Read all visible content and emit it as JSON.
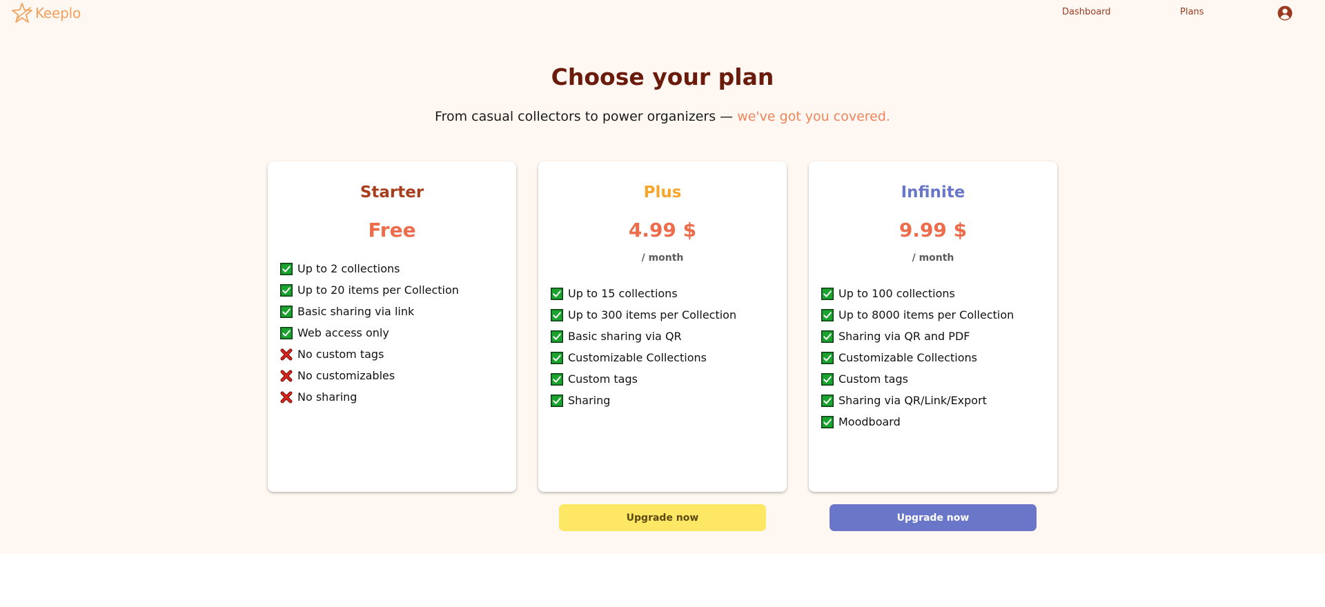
{
  "header": {
    "logo_text": "Keeplo",
    "nav": [
      {
        "label": "Dashboard"
      },
      {
        "label": "Plans"
      }
    ],
    "account_icon": "account-circle-icon"
  },
  "hero": {
    "title": "Choose your plan",
    "subtitle_main": "From casual collectors to power organizers — ",
    "subtitle_accent": "we've got you covered."
  },
  "colors": {
    "background": "#fff8f2",
    "brand_orange": "#f3a05c",
    "title": "#6b1b0b",
    "price": "#ec6c4c",
    "starter": "#a83e1e",
    "plus": "#f8a52c",
    "infinite": "#6a77c8",
    "check": "#1aa32f",
    "cross": "#c8201a"
  },
  "plans": [
    {
      "name": "Starter",
      "price": "Free",
      "period": "",
      "features": [
        {
          "text": "Up to 2 collections",
          "included": true,
          "icon": "check-icon"
        },
        {
          "text": "Up to 20 items per Collection",
          "included": true,
          "icon": "check-icon"
        },
        {
          "text": "Basic sharing via link",
          "included": true,
          "icon": "check-icon"
        },
        {
          "text": "Web access only",
          "included": true,
          "icon": "check-icon"
        },
        {
          "text": "No custom tags",
          "included": false,
          "icon": "cross-icon"
        },
        {
          "text": "No customizables",
          "included": false,
          "icon": "cross-icon"
        },
        {
          "text": "No sharing",
          "included": false,
          "icon": "cross-icon"
        }
      ]
    },
    {
      "name": "Plus",
      "price": "4.99 $",
      "period": "/ month",
      "button": "Upgrade now",
      "features": [
        {
          "text": "Up to 15 collections",
          "included": true,
          "icon": "check-icon"
        },
        {
          "text": "Up to 300 items per Collection",
          "included": true,
          "icon": "check-icon"
        },
        {
          "text": "Basic sharing via QR",
          "included": true,
          "icon": "check-icon"
        },
        {
          "text": "Customizable Collections",
          "included": true,
          "icon": "check-icon"
        },
        {
          "text": "Custom tags",
          "included": true,
          "icon": "check-icon"
        },
        {
          "text": "Sharing",
          "included": true,
          "icon": "check-icon"
        }
      ]
    },
    {
      "name": "Infinite",
      "price": "9.99 $",
      "period": "/ month",
      "button": "Upgrade now",
      "features": [
        {
          "text": "Up to 100 collections",
          "included": true,
          "icon": "check-icon"
        },
        {
          "text": "Up to 8000 items per Collection",
          "included": true,
          "icon": "check-icon"
        },
        {
          "text": "Sharing via QR and PDF",
          "included": true,
          "icon": "check-icon"
        },
        {
          "text": "Customizable Collections",
          "included": true,
          "icon": "check-icon"
        },
        {
          "text": "Custom tags",
          "included": true,
          "icon": "check-icon"
        },
        {
          "text": "Sharing via QR/Link/Export",
          "included": true,
          "icon": "check-icon"
        },
        {
          "text": "Moodboard",
          "included": true,
          "icon": "check-icon"
        }
      ]
    }
  ]
}
